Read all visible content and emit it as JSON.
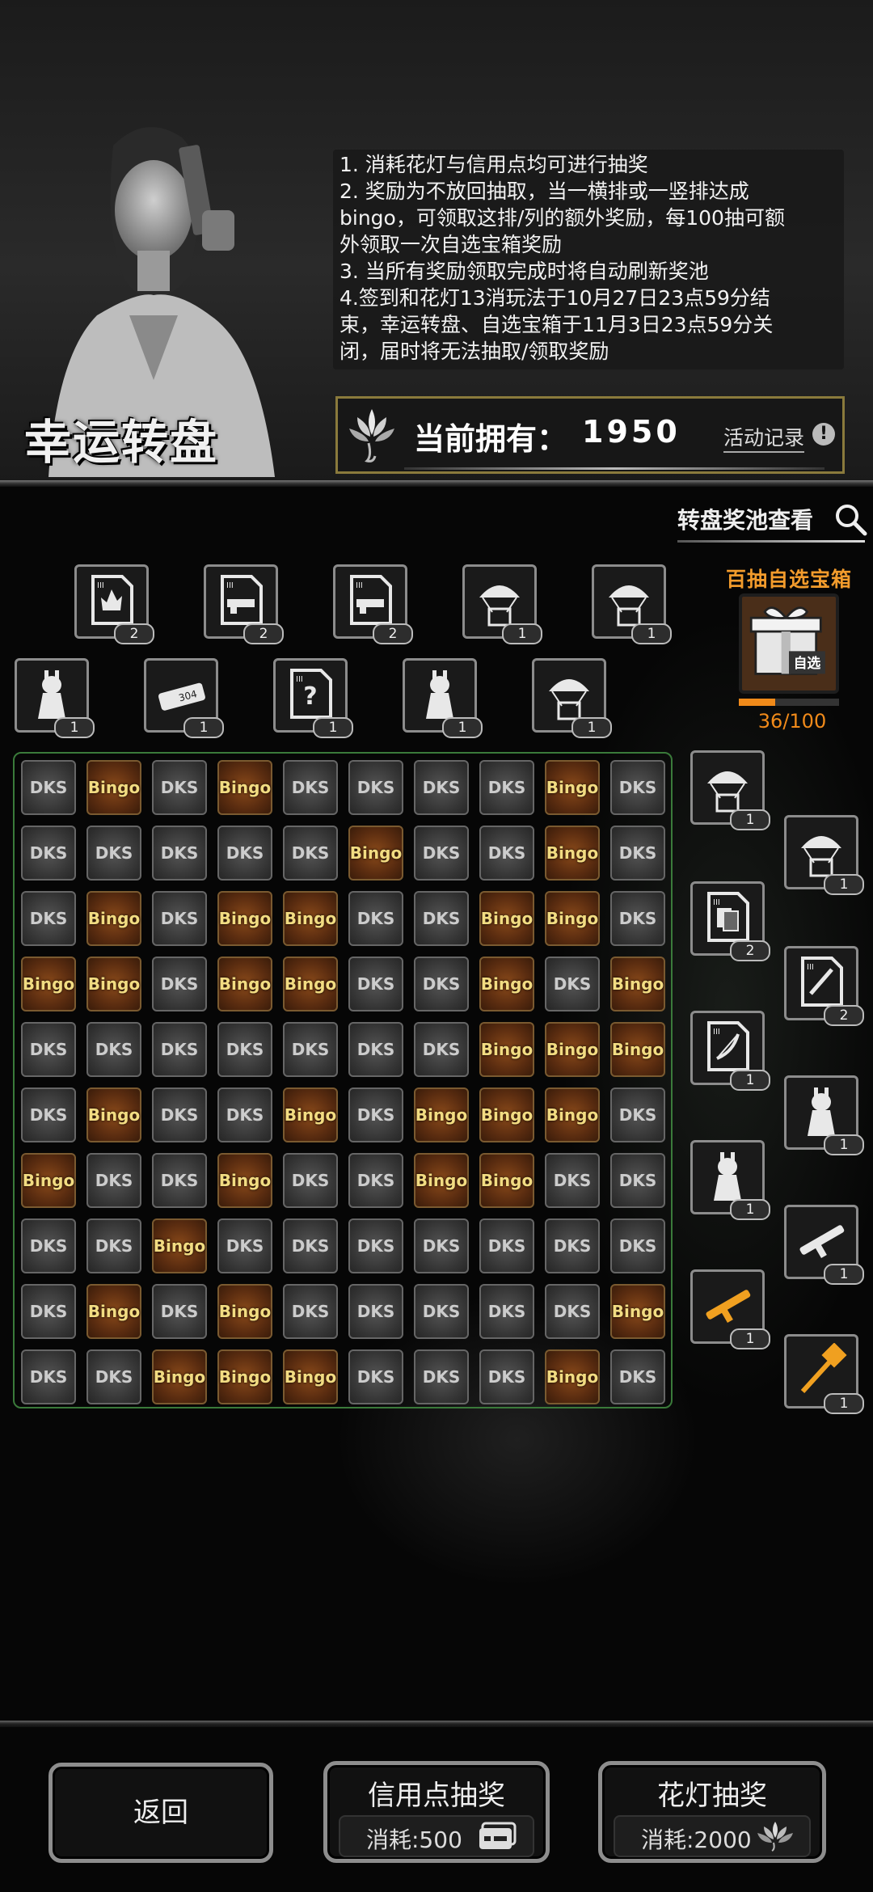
{
  "header": {
    "title": "幸运转盘",
    "rules": [
      "1. 消耗花灯与信用点均可进行抽奖",
      "2. 奖励为不放回抽取，当一横排或一竖排达成",
      "bingo，可领取这排/列的额外奖励，每100抽可额",
      "外领取一次自选宝箱奖励",
      "3. 当所有奖励领取完成时将自动刷新奖池",
      "4.签到和花灯13消玩法于10月27日23点59分结",
      "束，幸运转盘、自选宝箱于11月3日23点59分关",
      "闭，届时将无法抽取/领取奖励"
    ],
    "owned_label": "当前拥有：",
    "owned_value": "1950",
    "record_label": "活动记录",
    "record_icon": "!"
  },
  "pool_view_label": "转盘奖池查看",
  "top_rewards": [
    {
      "icon": "blueprint-fire-icon",
      "count": "2"
    },
    {
      "icon": "blueprint-gun-upgrade-icon",
      "count": "2"
    },
    {
      "icon": "blueprint-gun-sound-icon",
      "count": "2"
    },
    {
      "icon": "airdrop-bike-icon",
      "count": "1"
    },
    {
      "icon": "airdrop-gun-icon",
      "count": "1"
    },
    {
      "icon": "card-rabbit-icon",
      "count": "1"
    },
    {
      "icon": "ammo-304-icon",
      "count": "1"
    },
    {
      "icon": "mystery-blueprint-icon",
      "count": "1"
    },
    {
      "icon": "rabbit-mount-icon",
      "count": "1"
    },
    {
      "icon": "airdrop-gun-icon",
      "count": "1"
    }
  ],
  "chest": {
    "label": "百抽自选宝箱",
    "box_text": "自选",
    "progress_text": "36/100",
    "progress_fraction": 0.36
  },
  "grid": {
    "rows": [
      [
        "DKS",
        "Bingo",
        "DKS",
        "Bingo",
        "DKS",
        "DKS",
        "DKS",
        "DKS",
        "Bingo",
        "DKS"
      ],
      [
        "DKS",
        "DKS",
        "DKS",
        "DKS",
        "DKS",
        "Bingo",
        "DKS",
        "DKS",
        "Bingo",
        "DKS"
      ],
      [
        "DKS",
        "Bingo",
        "DKS",
        "Bingo",
        "Bingo",
        "DKS",
        "DKS",
        "Bingo",
        "Bingo",
        "DKS"
      ],
      [
        "Bingo",
        "Bingo",
        "DKS",
        "Bingo",
        "Bingo",
        "DKS",
        "DKS",
        "Bingo",
        "DKS",
        "Bingo"
      ],
      [
        "DKS",
        "DKS",
        "DKS",
        "DKS",
        "DKS",
        "DKS",
        "DKS",
        "Bingo",
        "Bingo",
        "Bingo"
      ],
      [
        "DKS",
        "Bingo",
        "DKS",
        "DKS",
        "Bingo",
        "DKS",
        "Bingo",
        "Bingo",
        "Bingo",
        "DKS"
      ],
      [
        "Bingo",
        "DKS",
        "DKS",
        "Bingo",
        "DKS",
        "DKS",
        "Bingo",
        "Bingo",
        "DKS",
        "DKS"
      ],
      [
        "DKS",
        "DKS",
        "Bingo",
        "DKS",
        "DKS",
        "DKS",
        "DKS",
        "DKS",
        "DKS",
        "DKS"
      ],
      [
        "DKS",
        "Bingo",
        "DKS",
        "Bingo",
        "DKS",
        "DKS",
        "DKS",
        "DKS",
        "DKS",
        "Bingo"
      ],
      [
        "DKS",
        "DKS",
        "Bingo",
        "Bingo",
        "Bingo",
        "DKS",
        "DKS",
        "DKS",
        "Bingo",
        "DKS"
      ]
    ]
  },
  "side_rewards": [
    {
      "icon": "airdrop-gun-icon",
      "count": "1"
    },
    {
      "icon": "airdrop-gun-icon",
      "count": "1"
    },
    {
      "icon": "blueprint-cards-icon",
      "count": "2"
    },
    {
      "icon": "blueprint-sword-icon",
      "count": "2"
    },
    {
      "icon": "blueprint-bow-icon",
      "count": "1"
    },
    {
      "icon": "rabbit-costume-icon",
      "count": "1"
    },
    {
      "icon": "cat-costume-icon",
      "count": "1"
    },
    {
      "icon": "rocket-launcher-icon",
      "count": "1"
    },
    {
      "icon": "golden-rifle-icon",
      "count": "1"
    },
    {
      "icon": "golden-hammer-icon",
      "count": "1"
    }
  ],
  "buttons": {
    "back": "返回",
    "credit_draw": {
      "title": "信用点抽奖",
      "cost": "消耗:500",
      "icon": "credit-card-icon"
    },
    "lantern_draw": {
      "title": "花灯抽奖",
      "cost": "消耗:2000",
      "icon": "lotus-lantern-icon"
    }
  },
  "colors": {
    "accent_orange": "#f08a1a",
    "bingo_text": "#f2dc82",
    "grid_border": "#3a7a3a"
  }
}
